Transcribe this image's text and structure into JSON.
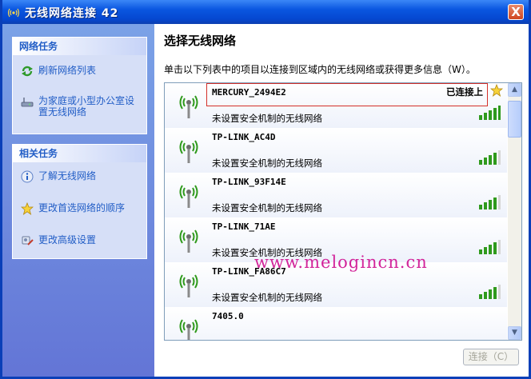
{
  "window": {
    "title": "无线网络连接 42",
    "close_label": "X"
  },
  "sidebar": {
    "network_tasks": {
      "header": "网络任务",
      "items": [
        {
          "label": "刷新网络列表",
          "icon": "refresh-icon"
        },
        {
          "label": "为家庭或小型办公室设置无线网络",
          "icon": "wireless-setup-icon"
        }
      ]
    },
    "related_tasks": {
      "header": "相关任务",
      "items": [
        {
          "label": "了解无线网络",
          "icon": "info-icon"
        },
        {
          "label": "更改首选网络的顺序",
          "icon": "star-icon"
        },
        {
          "label": "更改高级设置",
          "icon": "settings-icon"
        }
      ]
    }
  },
  "main": {
    "title": "选择无线网络",
    "description": "单击以下列表中的项目以连接到区域内的无线网络或获得更多信息（W）。",
    "networks": [
      {
        "ssid": "MERCURY_2494E2",
        "security": "未设置安全机制的无线网络",
        "status": "已连接上",
        "signal": 5,
        "preferred": true
      },
      {
        "ssid": "TP-LINK_AC4D",
        "security": "未设置安全机制的无线网络",
        "status": "",
        "signal": 4,
        "preferred": false
      },
      {
        "ssid": "TP-LINK_93F14E",
        "security": "未设置安全机制的无线网络",
        "status": "",
        "signal": 4,
        "preferred": false
      },
      {
        "ssid": "TP-LINK_71AE",
        "security": "未设置安全机制的无线网络",
        "status": "",
        "signal": 4,
        "preferred": false
      },
      {
        "ssid": "TP-LINK_FA86C7",
        "security": "未设置安全机制的无线网络",
        "status": "",
        "signal": 4,
        "preferred": false
      },
      {
        "ssid": "7405.0",
        "security": "",
        "status": "",
        "signal": 0,
        "preferred": false
      }
    ],
    "connect_label": "连接（C）"
  },
  "watermark": "www.melogincn.cn",
  "colors": {
    "title_bar": "#0a56e0",
    "link": "#215dc6",
    "selected_border": "#d4302a",
    "signal_green": "#2f9a1c",
    "watermark": "#d2249a"
  }
}
